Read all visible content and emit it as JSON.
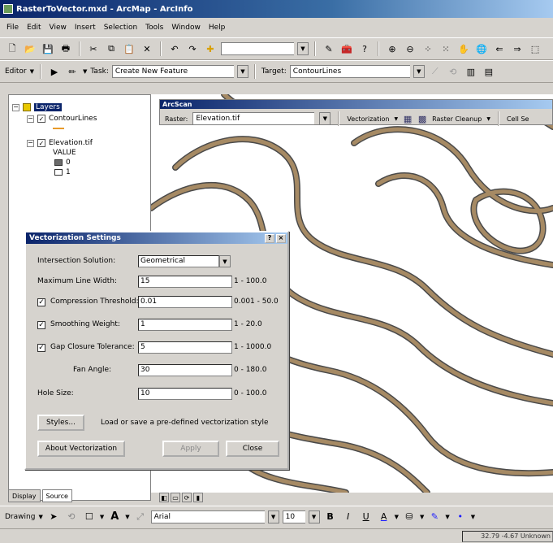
{
  "window": {
    "title": "RasterToVector.mxd - ArcMap - ArcInfo"
  },
  "menu": [
    "File",
    "Edit",
    "View",
    "Insert",
    "Selection",
    "Tools",
    "Window",
    "Help"
  ],
  "standard_toolbar": {
    "scale_value": "",
    "icons": [
      "new-icon",
      "open-icon",
      "save-icon",
      "print-icon",
      "cut-icon",
      "copy-icon",
      "paste-icon",
      "delete-icon",
      "undo-icon",
      "redo-icon",
      "add-data-icon"
    ]
  },
  "editor_toolbar": {
    "editor_label": "Editor",
    "task_label": "Task:",
    "task_value": "Create New Feature",
    "target_label": "Target:",
    "target_value": "ContourLines"
  },
  "toc": {
    "root": "Layers",
    "layers": [
      {
        "name": "ContourLines",
        "checked": true
      },
      {
        "name": "Elevation.tif",
        "checked": true,
        "legend_title": "VALUE",
        "legend": [
          {
            "label": "0",
            "color": "#6b6b6b"
          },
          {
            "label": "1",
            "color": "#ffffff"
          }
        ]
      }
    ],
    "tabs": [
      "Display",
      "Source"
    ]
  },
  "arcscan": {
    "title": "ArcScan",
    "raster_label": "Raster:",
    "raster_value": "Elevation.tif",
    "vectorization": "Vectorization",
    "raster_cleanup": "Raster Cleanup",
    "cell_select": "Cell Se"
  },
  "dialog": {
    "title": "Vectorization Settings",
    "intersection_label": "Intersection Solution:",
    "intersection_value": "Geometrical",
    "max_width_label": "Maximum Line Width:",
    "max_width_value": "15",
    "max_width_range": "1 - 100.0",
    "compression_label": "Compression Threshold:",
    "compression_value": "0.01",
    "compression_range": "0.001 - 50.0",
    "smoothing_label": "Smoothing Weight:",
    "smoothing_value": "1",
    "smoothing_range": "1 - 20.0",
    "gap_label": "Gap Closure Tolerance:",
    "gap_value": "5",
    "gap_range": "1 - 1000.0",
    "fan_label": "Fan Angle:",
    "fan_value": "30",
    "fan_range": "0 - 180.0",
    "hole_label": "Hole Size:",
    "hole_value": "10",
    "hole_range": "0 - 100.0",
    "styles_button": "Styles...",
    "styles_note": "Load or save a pre-defined vectorization style",
    "about_button": "About Vectorization",
    "apply_button": "Apply",
    "close_button": "Close"
  },
  "drawing_toolbar": {
    "drawing_label": "Drawing",
    "font": "Arial",
    "size": "10"
  },
  "status": {
    "coordinates": "32.79 -4.67 Unknown"
  },
  "colors": {
    "contour": "#a68a64",
    "contour_edge": "#4a4a4a",
    "title_bar": "#0a246a"
  }
}
